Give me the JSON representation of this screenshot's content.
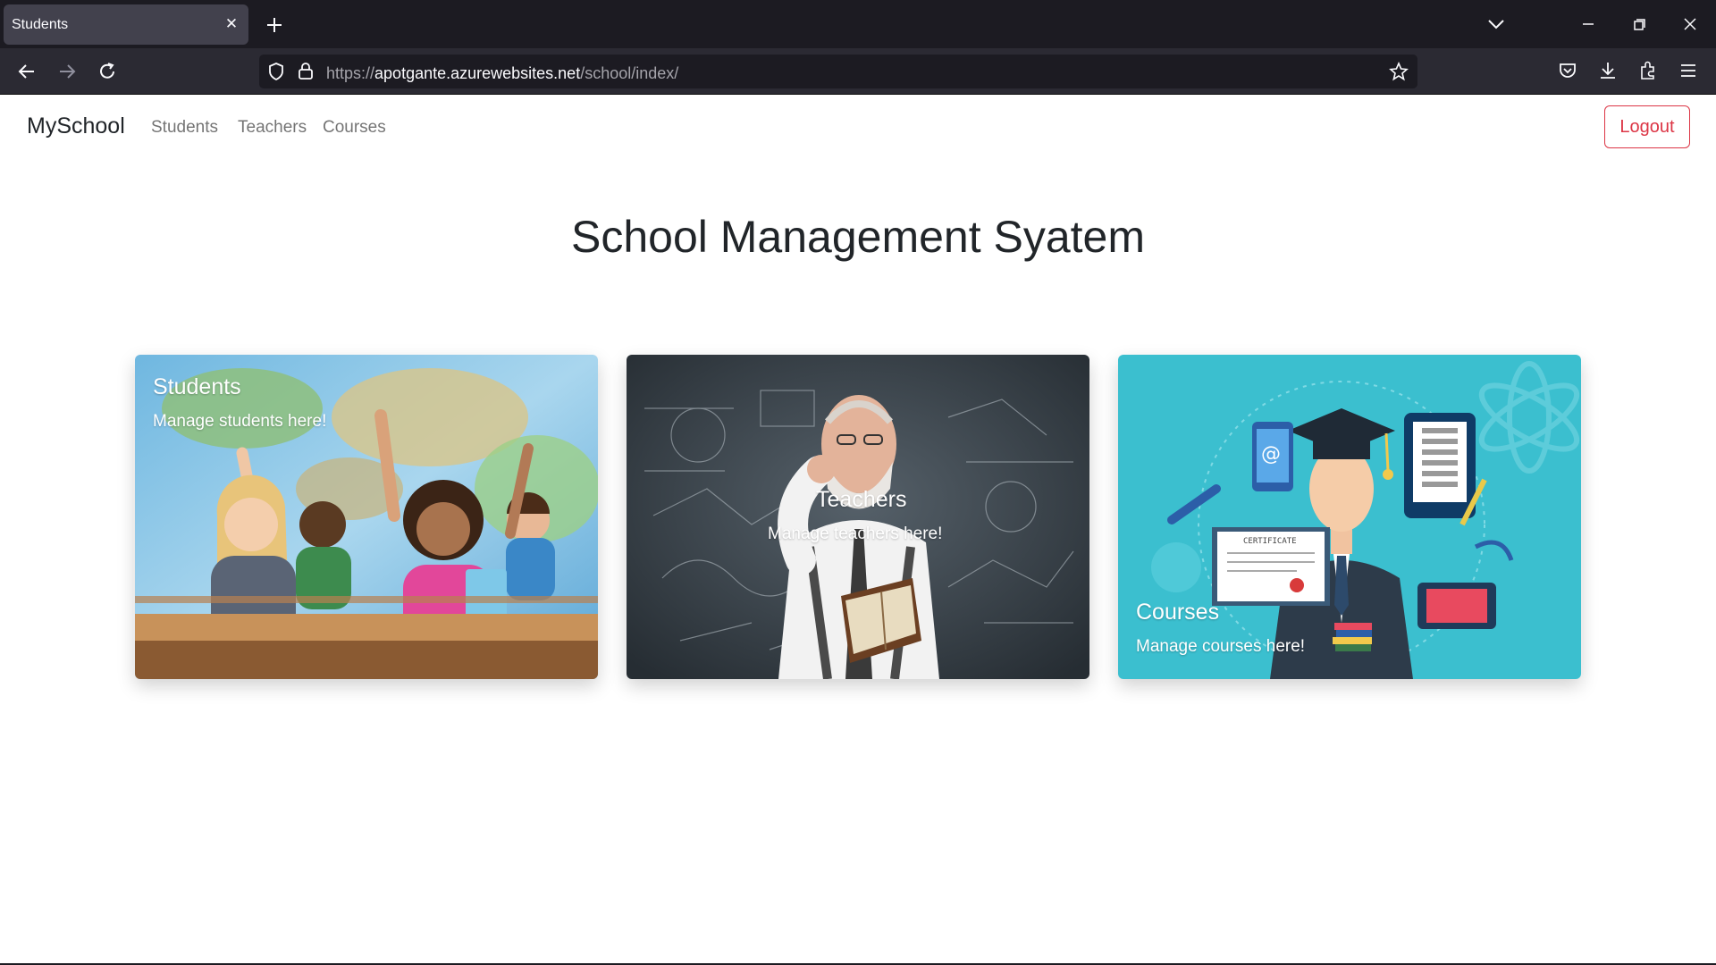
{
  "browser": {
    "tab_title": "Students",
    "url_prefix": "https://",
    "url_domain": "apotgante.azurewebsites.net",
    "url_path": "/school/index/"
  },
  "navbar": {
    "brand": "MySchool",
    "links": [
      "Students",
      "Teachers",
      "Courses"
    ],
    "logout": "Logout"
  },
  "page": {
    "title": "School Management Syatem"
  },
  "cards": [
    {
      "title": "Students",
      "text": "Manage students here!"
    },
    {
      "title": "Teachers",
      "text": "Manage teachers here!"
    },
    {
      "title": "Courses",
      "text": "Manage courses here!"
    }
  ],
  "colors": {
    "logout": "#dc3545",
    "courses_bg": "#3bbfcf"
  },
  "certificate_label": "CERTIFICATE"
}
